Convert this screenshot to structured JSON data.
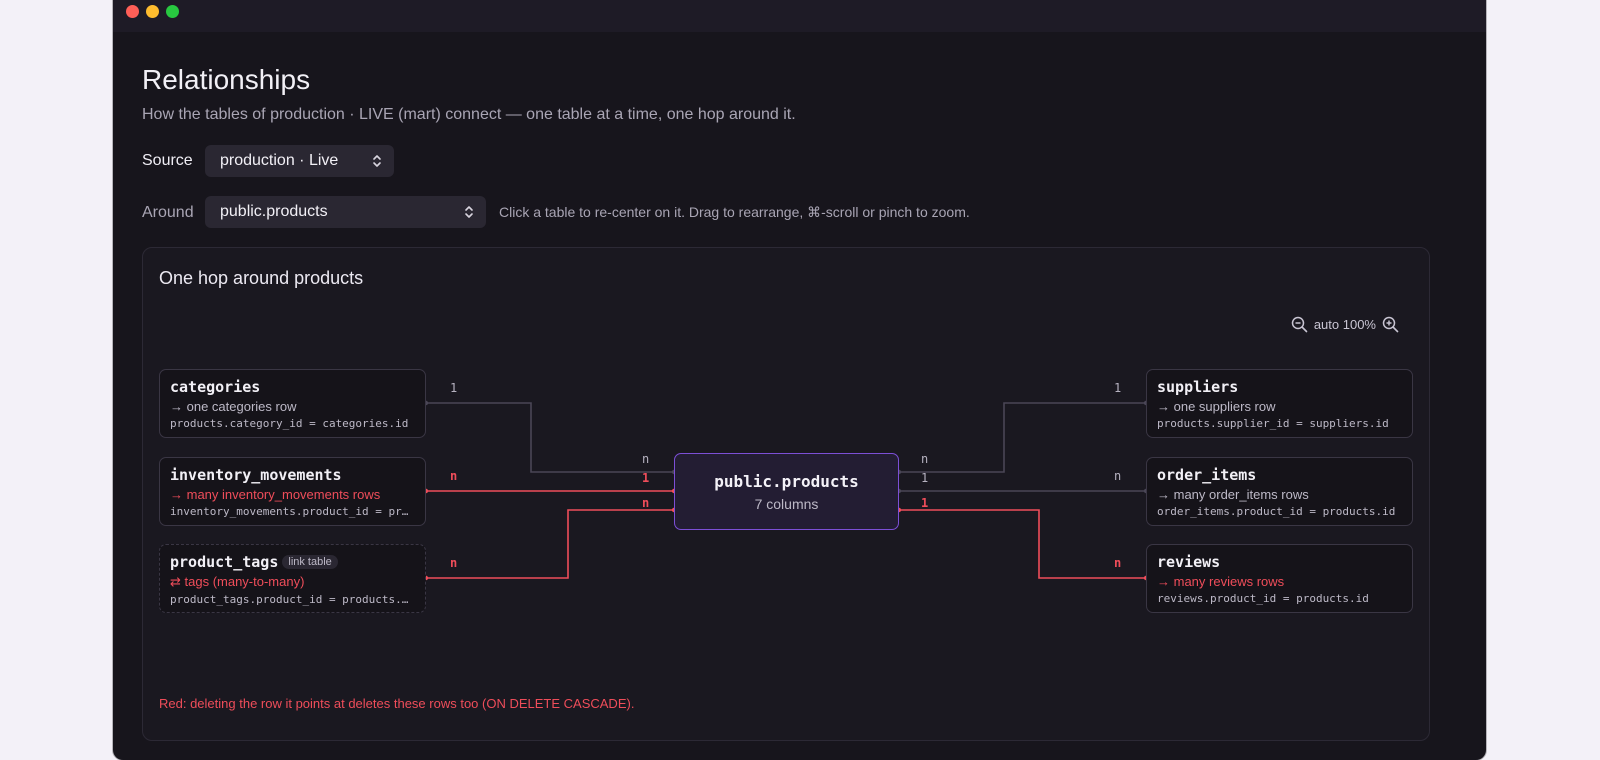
{
  "page": {
    "title": "Relationships",
    "subtitle": "How the tables of production · LIVE (mart) connect — one table at a time, one hop around it."
  },
  "source": {
    "label": "Source",
    "value": "production · Live"
  },
  "around": {
    "label": "Around",
    "value": "public.products"
  },
  "hint": "Click a table to re-center on it. Drag to rearrange, ⌘-scroll or pinch to zoom.",
  "panel": {
    "title": "One hop around products",
    "zoom": {
      "label": "auto 100%",
      "zoom_out_icon": "zoom-out-icon",
      "zoom_in_icon": "zoom-in-icon"
    },
    "legend": "Red: deleting the row it points at deletes these rows too (ON DELETE CASCADE)."
  },
  "center": {
    "name": "public.products",
    "columns": "7 columns"
  },
  "tables": [
    {
      "name": "categories",
      "rel": "→ one categories row",
      "join": "products.category_id = categories.id",
      "cascade": false,
      "link": false,
      "far_card": "1",
      "near_card": "n"
    },
    {
      "name": "inventory_movements",
      "rel": "→ many inventory_movements rows",
      "join": "inventory_movements.product_id = products.id",
      "cascade": true,
      "link": false,
      "far_card": "n",
      "near_card": "1"
    },
    {
      "name": "product_tags",
      "badge": "link table",
      "rel": "⇄ tags (many-to-many)",
      "join": "product_tags.product_id = products.id",
      "cascade": true,
      "link": true,
      "far_card": "n",
      "near_card": "n"
    },
    {
      "name": "suppliers",
      "rel": "→ one suppliers row",
      "join": "products.supplier_id = suppliers.id",
      "cascade": false,
      "link": false,
      "far_card": "1",
      "near_card": "n"
    },
    {
      "name": "order_items",
      "rel": "→ many order_items rows",
      "join": "order_items.product_id = products.id",
      "cascade": false,
      "link": false,
      "far_card": "n",
      "near_card": "1"
    },
    {
      "name": "reviews",
      "rel": "→ many reviews rows",
      "join": "reviews.product_id = products.id",
      "cascade": true,
      "link": false,
      "far_card": "n",
      "near_card": "1"
    }
  ],
  "colors": {
    "cascade": "#ef4d5a",
    "normal": "#4a4656",
    "accent": "#7c4fd6"
  }
}
